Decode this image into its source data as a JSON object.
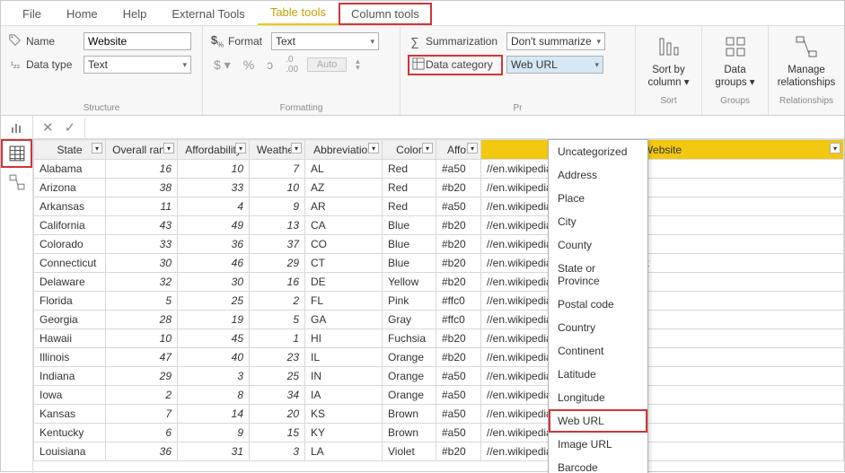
{
  "tabs": [
    "File",
    "Home",
    "Help",
    "External Tools",
    "Table tools",
    "Column tools"
  ],
  "active_tab": "Table tools",
  "highlighted_tab": "Column tools",
  "structure": {
    "name_label": "Name",
    "name_value": "Website",
    "datatype_label": "Data type",
    "datatype_value": "Text",
    "group_label": "Structure"
  },
  "formatting": {
    "format_label": "Format",
    "format_value": "Text",
    "auto": "Auto",
    "group_label": "Formatting"
  },
  "properties": {
    "summarization_label": "Summarization",
    "summarization_value": "Don't summarize",
    "datacategory_label": "Data category",
    "datacategory_value": "Web URL",
    "group_label": "Properties",
    "group_label_short": "Pr"
  },
  "sort": {
    "label": "Sort by\ncolumn",
    "group": "Sort"
  },
  "groups": {
    "label": "Data\ngroups",
    "group": "Groups"
  },
  "relationships": {
    "label": "Manage\nrelationships",
    "group": "Relationships"
  },
  "dropdown_options": [
    "Uncategorized",
    "Address",
    "Place",
    "City",
    "County",
    "State or Province",
    "Postal code",
    "Country",
    "Continent",
    "Latitude",
    "Longitude",
    "Web URL",
    "Image URL",
    "Barcode"
  ],
  "dropdown_highlight": "Web URL",
  "columns": [
    "State",
    "Overall rank",
    "Affordability",
    "Weather",
    "Abbreviation",
    "Color",
    "Affor",
    "Website"
  ],
  "selected_column": "Website",
  "rows": [
    {
      "state": "Alabama",
      "rank": 16,
      "aff": 10,
      "wx": 7,
      "abbr": "AL",
      "color": "Red",
      "aff2": "#a50",
      "site": "//en.wikipedia.org/wiki/alabama"
    },
    {
      "state": "Arizona",
      "rank": 38,
      "aff": 33,
      "wx": 10,
      "abbr": "AZ",
      "color": "Red",
      "aff2": "#b20",
      "site": "//en.wikipedia.org/wiki/arizona"
    },
    {
      "state": "Arkansas",
      "rank": 11,
      "aff": 4,
      "wx": 9,
      "abbr": "AR",
      "color": "Red",
      "aff2": "#a50",
      "site": "//en.wikipedia.org/wiki/arkansas"
    },
    {
      "state": "California",
      "rank": 43,
      "aff": 49,
      "wx": 13,
      "abbr": "CA",
      "color": "Blue",
      "aff2": "#b20",
      "site": "//en.wikipedia.org/wiki/california"
    },
    {
      "state": "Colorado",
      "rank": 33,
      "aff": 36,
      "wx": 37,
      "abbr": "CO",
      "color": "Blue",
      "aff2": "#b20",
      "site": "//en.wikipedia.org/wiki/colorado"
    },
    {
      "state": "Connecticut",
      "rank": 30,
      "aff": 46,
      "wx": 29,
      "abbr": "CT",
      "color": "Blue",
      "aff2": "#b20",
      "site": "//en.wikipedia.org/wiki/connecticut"
    },
    {
      "state": "Delaware",
      "rank": 32,
      "aff": 30,
      "wx": 16,
      "abbr": "DE",
      "color": "Yellow",
      "aff2": "#b20",
      "site": "//en.wikipedia.org/wiki/delaware"
    },
    {
      "state": "Florida",
      "rank": 5,
      "aff": 25,
      "wx": 2,
      "abbr": "FL",
      "color": "Pink",
      "aff2": "#ffc0",
      "site": "//en.wikipedia.org/wiki/florida"
    },
    {
      "state": "Georgia",
      "rank": 28,
      "aff": 19,
      "wx": 5,
      "abbr": "GA",
      "color": "Gray",
      "aff2": "#ffc0",
      "site": "//en.wikipedia.org/wiki/georgia"
    },
    {
      "state": "Hawaii",
      "rank": 10,
      "aff": 45,
      "wx": 1,
      "abbr": "HI",
      "color": "Fuchsia",
      "aff2": "#b20",
      "site": "//en.wikipedia.org/wiki/hawaii"
    },
    {
      "state": "Illinois",
      "rank": 47,
      "aff": 40,
      "wx": 23,
      "abbr": "IL",
      "color": "Orange",
      "aff2": "#b20",
      "site": "//en.wikipedia.org/wiki/illinois"
    },
    {
      "state": "Indiana",
      "rank": 29,
      "aff": 3,
      "wx": 25,
      "abbr": "IN",
      "color": "Orange",
      "aff2": "#a50",
      "site": "//en.wikipedia.org/wiki/indiana"
    },
    {
      "state": "Iowa",
      "rank": 2,
      "aff": 8,
      "wx": 34,
      "abbr": "IA",
      "color": "Orange",
      "aff2": "#a50",
      "site": "//en.wikipedia.org/wiki/iowa"
    },
    {
      "state": "Kansas",
      "rank": 7,
      "aff": 14,
      "wx": 20,
      "abbr": "KS",
      "color": "Brown",
      "aff2": "#a50",
      "site": "//en.wikipedia.org/wiki/kansas"
    },
    {
      "state": "Kentucky",
      "rank": 6,
      "aff": 9,
      "wx": 15,
      "abbr": "KY",
      "color": "Brown",
      "aff2": "#a50",
      "site": "//en.wikipedia.org/wiki/kentucky"
    },
    {
      "state": "Louisiana",
      "rank": 36,
      "aff": 31,
      "wx": 3,
      "abbr": "LA",
      "color": "Violet",
      "aff2": "#b20",
      "site": "//en.wikipedia.org/wiki/louisiana"
    }
  ]
}
